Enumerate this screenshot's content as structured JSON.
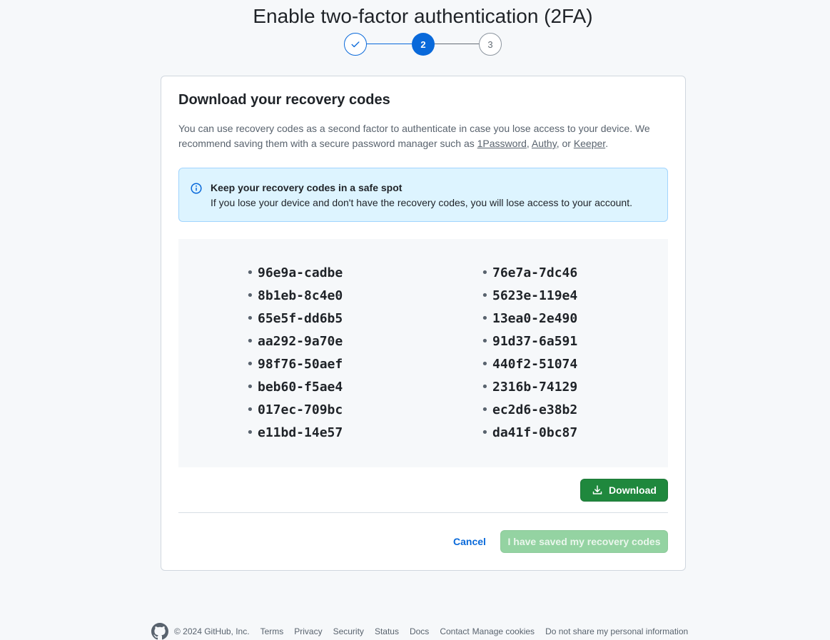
{
  "page": {
    "title": "Enable two-factor authentication (2FA)"
  },
  "stepper": {
    "steps": [
      {
        "label": "",
        "state": "complete",
        "icon": "check-icon"
      },
      {
        "label": "2",
        "state": "current"
      },
      {
        "label": "3",
        "state": "upcoming"
      }
    ]
  },
  "card": {
    "title": "Download your recovery codes",
    "description_prefix": "You can use recovery codes as a second factor to authenticate in case you lose access to your device. We recommend saving them with a secure password manager such as ",
    "links": [
      "1Password",
      "Authy",
      "Keeper"
    ],
    "sep1": ", ",
    "sep2": ", or ",
    "end": "."
  },
  "flash": {
    "icon": "info-icon",
    "title": "Keep your recovery codes in a safe spot",
    "body": "If you lose your device and don't have the recovery codes, you will lose access to your account."
  },
  "codes": {
    "column1": [
      "96e9a-cadbe",
      "8b1eb-8c4e0",
      "65e5f-dd6b5",
      "aa292-9a70e",
      "98f76-50aef",
      "beb60-f5ae4",
      "017ec-709bc",
      "e11bd-14e57"
    ],
    "column2": [
      "76e7a-7dc46",
      "5623e-119e4",
      "13ea0-2e490",
      "91d37-6a591",
      "440f2-51074",
      "2316b-74129",
      "ec2d6-e38b2",
      "da41f-0bc87"
    ]
  },
  "actions": {
    "download_label": "Download",
    "download_icon": "download-icon",
    "cancel_label": "Cancel",
    "saved_label": "I have saved my recovery codes",
    "saved_disabled": true
  },
  "footer": {
    "logo": "github-icon",
    "copyright": "© 2024 GitHub, Inc.",
    "links": [
      "Terms",
      "Privacy",
      "Security",
      "Status",
      "Docs",
      "Contact",
      "Manage cookies",
      "Do not share my personal information"
    ]
  },
  "colors": {
    "accent": "#0969da",
    "primary_button": "#1f883d",
    "primary_button_disabled": "#94d3a2",
    "flash_bg": "#ddf4ff"
  }
}
